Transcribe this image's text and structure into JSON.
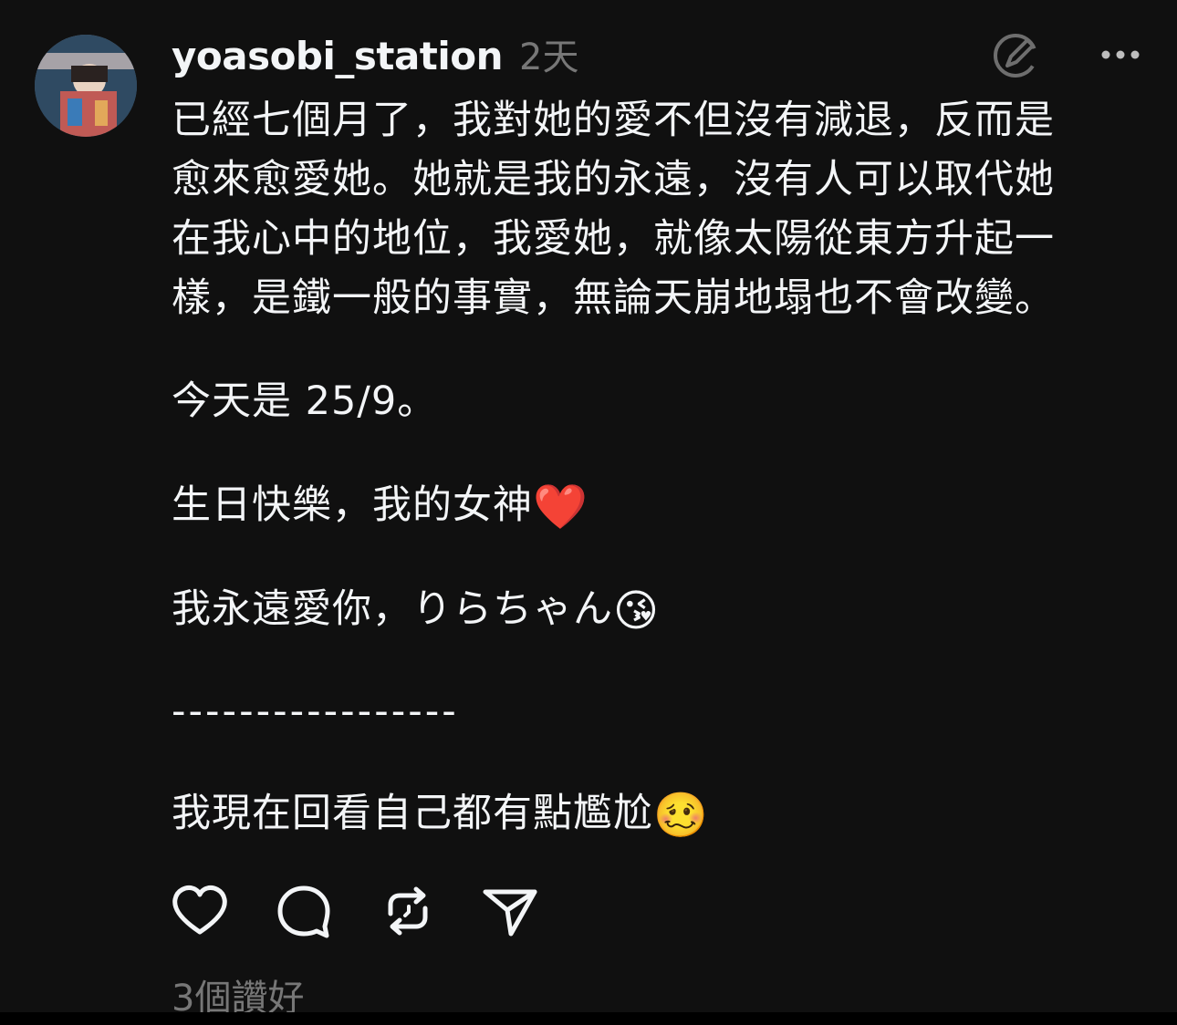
{
  "post": {
    "username": "yoasobi_station",
    "timestamp": "2天",
    "body_lines": [
      "已經七個月了，我對她的愛不但沒有減退，反而是",
      "愈來愈愛她。她就是我的永遠，沒有人可以取代她",
      "在我心中的地位，我愛她，就像太陽從東方升起一",
      "樣，是鐵一般的事實，無論天崩地塌也不會改變。"
    ],
    "para_date": "今天是 25/9。",
    "para_birthday": "生日快樂，我的女神",
    "para_birthday_emoji": "❤️",
    "para_love": "我永遠愛你，りらちゃん",
    "para_love_emoji": "😘",
    "separator": "-----------------",
    "para_awkward": "我現在回看自己都有點尷尬",
    "para_awkward_emoji": "🥴",
    "likes": "3個讚好"
  },
  "icons": {
    "edit": "edit-icon",
    "more": "more-icon",
    "like": "heart-icon",
    "comment": "comment-icon",
    "repost": "repost-icon",
    "share": "send-icon"
  },
  "colors": {
    "background": "#101010",
    "text": "#f3f5f7",
    "muted": "#777777",
    "heart_emoji": "#e0202b"
  }
}
